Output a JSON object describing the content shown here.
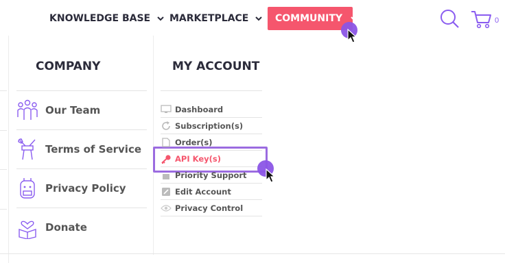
{
  "nav": {
    "items": [
      {
        "label": "KNOWLEDGE BASE"
      },
      {
        "label": "MARKETPLACE"
      },
      {
        "label": "COMMUNITY"
      }
    ],
    "cart_count": "0"
  },
  "menu": {
    "company": {
      "heading": "COMPANY",
      "items": [
        {
          "label": "Our Team",
          "icon": "team-icon"
        },
        {
          "label": "Terms of Service",
          "icon": "tools-icon"
        },
        {
          "label": "Privacy Policy",
          "icon": "backpack-icon"
        },
        {
          "label": "Donate",
          "icon": "donate-box-icon"
        }
      ]
    },
    "account": {
      "heading": "MY ACCOUNT",
      "items": [
        {
          "label": "Dashboard",
          "icon": "monitor-icon"
        },
        {
          "label": "Subscription(s)",
          "icon": "refresh-icon"
        },
        {
          "label": "Order(s)",
          "icon": "document-icon"
        },
        {
          "label": "API Key(s)",
          "icon": "key-icon",
          "active": true
        },
        {
          "label": "Priority Support",
          "icon": "support-icon"
        },
        {
          "label": "Edit Account",
          "icon": "edit-icon"
        },
        {
          "label": "Privacy Control",
          "icon": "eye-icon"
        }
      ]
    }
  },
  "colors": {
    "accent": "#f5566d",
    "highlight": "#9b6be0",
    "cursor_dot": "#8b55e6",
    "icon_purple": "#8a5cf0"
  }
}
